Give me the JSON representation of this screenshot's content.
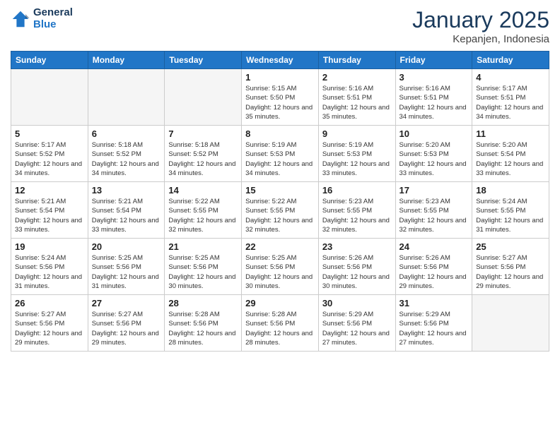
{
  "header": {
    "logo_general": "General",
    "logo_blue": "Blue",
    "title": "January 2025",
    "subtitle": "Kepanjen, Indonesia"
  },
  "weekdays": [
    "Sunday",
    "Monday",
    "Tuesday",
    "Wednesday",
    "Thursday",
    "Friday",
    "Saturday"
  ],
  "weeks": [
    [
      {
        "day": "",
        "sunrise": "",
        "sunset": "",
        "daylight": ""
      },
      {
        "day": "",
        "sunrise": "",
        "sunset": "",
        "daylight": ""
      },
      {
        "day": "",
        "sunrise": "",
        "sunset": "",
        "daylight": ""
      },
      {
        "day": "1",
        "sunrise": "Sunrise: 5:15 AM",
        "sunset": "Sunset: 5:50 PM",
        "daylight": "Daylight: 12 hours and 35 minutes."
      },
      {
        "day": "2",
        "sunrise": "Sunrise: 5:16 AM",
        "sunset": "Sunset: 5:51 PM",
        "daylight": "Daylight: 12 hours and 35 minutes."
      },
      {
        "day": "3",
        "sunrise": "Sunrise: 5:16 AM",
        "sunset": "Sunset: 5:51 PM",
        "daylight": "Daylight: 12 hours and 34 minutes."
      },
      {
        "day": "4",
        "sunrise": "Sunrise: 5:17 AM",
        "sunset": "Sunset: 5:51 PM",
        "daylight": "Daylight: 12 hours and 34 minutes."
      }
    ],
    [
      {
        "day": "5",
        "sunrise": "Sunrise: 5:17 AM",
        "sunset": "Sunset: 5:52 PM",
        "daylight": "Daylight: 12 hours and 34 minutes."
      },
      {
        "day": "6",
        "sunrise": "Sunrise: 5:18 AM",
        "sunset": "Sunset: 5:52 PM",
        "daylight": "Daylight: 12 hours and 34 minutes."
      },
      {
        "day": "7",
        "sunrise": "Sunrise: 5:18 AM",
        "sunset": "Sunset: 5:52 PM",
        "daylight": "Daylight: 12 hours and 34 minutes."
      },
      {
        "day": "8",
        "sunrise": "Sunrise: 5:19 AM",
        "sunset": "Sunset: 5:53 PM",
        "daylight": "Daylight: 12 hours and 34 minutes."
      },
      {
        "day": "9",
        "sunrise": "Sunrise: 5:19 AM",
        "sunset": "Sunset: 5:53 PM",
        "daylight": "Daylight: 12 hours and 33 minutes."
      },
      {
        "day": "10",
        "sunrise": "Sunrise: 5:20 AM",
        "sunset": "Sunset: 5:53 PM",
        "daylight": "Daylight: 12 hours and 33 minutes."
      },
      {
        "day": "11",
        "sunrise": "Sunrise: 5:20 AM",
        "sunset": "Sunset: 5:54 PM",
        "daylight": "Daylight: 12 hours and 33 minutes."
      }
    ],
    [
      {
        "day": "12",
        "sunrise": "Sunrise: 5:21 AM",
        "sunset": "Sunset: 5:54 PM",
        "daylight": "Daylight: 12 hours and 33 minutes."
      },
      {
        "day": "13",
        "sunrise": "Sunrise: 5:21 AM",
        "sunset": "Sunset: 5:54 PM",
        "daylight": "Daylight: 12 hours and 33 minutes."
      },
      {
        "day": "14",
        "sunrise": "Sunrise: 5:22 AM",
        "sunset": "Sunset: 5:55 PM",
        "daylight": "Daylight: 12 hours and 32 minutes."
      },
      {
        "day": "15",
        "sunrise": "Sunrise: 5:22 AM",
        "sunset": "Sunset: 5:55 PM",
        "daylight": "Daylight: 12 hours and 32 minutes."
      },
      {
        "day": "16",
        "sunrise": "Sunrise: 5:23 AM",
        "sunset": "Sunset: 5:55 PM",
        "daylight": "Daylight: 12 hours and 32 minutes."
      },
      {
        "day": "17",
        "sunrise": "Sunrise: 5:23 AM",
        "sunset": "Sunset: 5:55 PM",
        "daylight": "Daylight: 12 hours and 32 minutes."
      },
      {
        "day": "18",
        "sunrise": "Sunrise: 5:24 AM",
        "sunset": "Sunset: 5:55 PM",
        "daylight": "Daylight: 12 hours and 31 minutes."
      }
    ],
    [
      {
        "day": "19",
        "sunrise": "Sunrise: 5:24 AM",
        "sunset": "Sunset: 5:56 PM",
        "daylight": "Daylight: 12 hours and 31 minutes."
      },
      {
        "day": "20",
        "sunrise": "Sunrise: 5:25 AM",
        "sunset": "Sunset: 5:56 PM",
        "daylight": "Daylight: 12 hours and 31 minutes."
      },
      {
        "day": "21",
        "sunrise": "Sunrise: 5:25 AM",
        "sunset": "Sunset: 5:56 PM",
        "daylight": "Daylight: 12 hours and 30 minutes."
      },
      {
        "day": "22",
        "sunrise": "Sunrise: 5:25 AM",
        "sunset": "Sunset: 5:56 PM",
        "daylight": "Daylight: 12 hours and 30 minutes."
      },
      {
        "day": "23",
        "sunrise": "Sunrise: 5:26 AM",
        "sunset": "Sunset: 5:56 PM",
        "daylight": "Daylight: 12 hours and 30 minutes."
      },
      {
        "day": "24",
        "sunrise": "Sunrise: 5:26 AM",
        "sunset": "Sunset: 5:56 PM",
        "daylight": "Daylight: 12 hours and 29 minutes."
      },
      {
        "day": "25",
        "sunrise": "Sunrise: 5:27 AM",
        "sunset": "Sunset: 5:56 PM",
        "daylight": "Daylight: 12 hours and 29 minutes."
      }
    ],
    [
      {
        "day": "26",
        "sunrise": "Sunrise: 5:27 AM",
        "sunset": "Sunset: 5:56 PM",
        "daylight": "Daylight: 12 hours and 29 minutes."
      },
      {
        "day": "27",
        "sunrise": "Sunrise: 5:27 AM",
        "sunset": "Sunset: 5:56 PM",
        "daylight": "Daylight: 12 hours and 29 minutes."
      },
      {
        "day": "28",
        "sunrise": "Sunrise: 5:28 AM",
        "sunset": "Sunset: 5:56 PM",
        "daylight": "Daylight: 12 hours and 28 minutes."
      },
      {
        "day": "29",
        "sunrise": "Sunrise: 5:28 AM",
        "sunset": "Sunset: 5:56 PM",
        "daylight": "Daylight: 12 hours and 28 minutes."
      },
      {
        "day": "30",
        "sunrise": "Sunrise: 5:29 AM",
        "sunset": "Sunset: 5:56 PM",
        "daylight": "Daylight: 12 hours and 27 minutes."
      },
      {
        "day": "31",
        "sunrise": "Sunrise: 5:29 AM",
        "sunset": "Sunset: 5:56 PM",
        "daylight": "Daylight: 12 hours and 27 minutes."
      },
      {
        "day": "",
        "sunrise": "",
        "sunset": "",
        "daylight": ""
      }
    ]
  ]
}
